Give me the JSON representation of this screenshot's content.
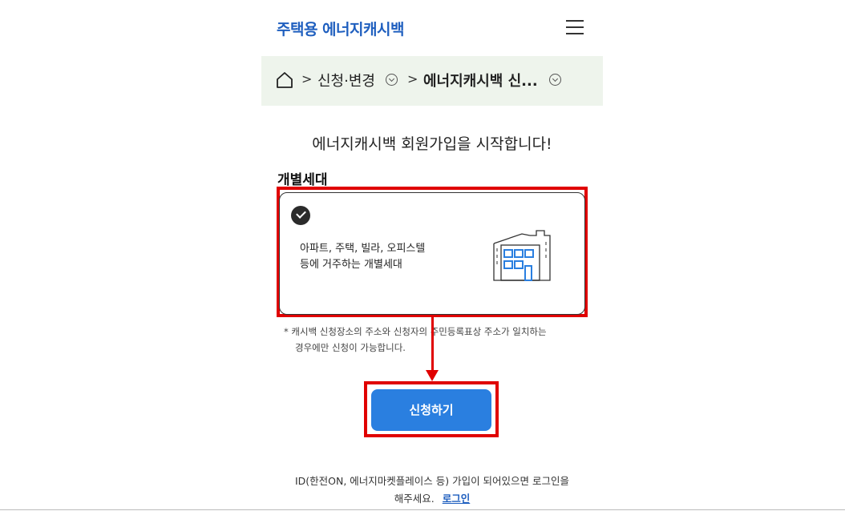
{
  "header": {
    "logo": "주택용 에너지캐시백",
    "menu_icon": "hamburger-menu-icon"
  },
  "breadcrumb": {
    "home_icon": "home-icon",
    "separator": ">",
    "items": [
      {
        "label": "신청·변경"
      },
      {
        "label": "에너지캐시백 신..."
      }
    ]
  },
  "main": {
    "title": "에너지캐시백 회원가입을 시작합니다!",
    "section_label": "개별세대"
  },
  "card": {
    "line1": "아파트, 주택, 빌라, 오피스텔",
    "line2": "등에 거주하는 개별세대",
    "icon": "building-icon",
    "selected": true
  },
  "notice": {
    "line1": "* 캐시백 신청장소의 주소와 신청자의 주민등록표상 주소가 일치하는",
    "line2": "경우에만 신청이 가능합니다."
  },
  "apply_button": {
    "label": "신청하기"
  },
  "footer": {
    "line1": "ID(한전ON, 에너지마켓플레이스 등) 가입이 되어있으면 로그인을",
    "line2": "해주세요.",
    "login_label": "로그인"
  },
  "colors": {
    "brand": "#1f5fbf",
    "button": "#2a7fe0",
    "highlight": "#e00000",
    "breadcrumb_bg": "#eef4ec"
  }
}
